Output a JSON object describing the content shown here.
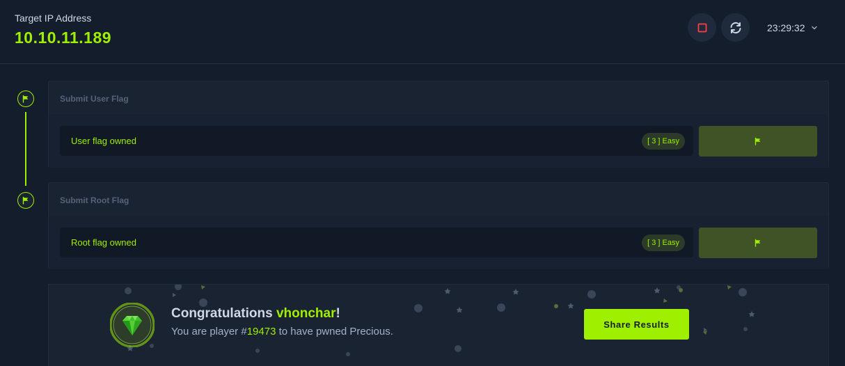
{
  "header": {
    "ip_label": "Target IP Address",
    "ip_value": "10.10.11.189",
    "timer": "23:29:32"
  },
  "icons": {
    "stop": "stop-square-icon",
    "reset": "refresh-icon",
    "chevron": "chevron-down-icon",
    "flag": "flag-icon",
    "gem": "green-gem-icon"
  },
  "flags": [
    {
      "title": "Submit User Flag",
      "status": "User flag owned",
      "difficulty": "[ 3 ] Easy"
    },
    {
      "title": "Submit Root Flag",
      "status": "Root flag owned",
      "difficulty": "[ 3 ] Easy"
    }
  ],
  "congrats": {
    "prefix": "Congratulations ",
    "username": "vhonchar",
    "suffix": "!",
    "sub_prefix": "You are player #",
    "player_number": "19473",
    "sub_suffix": " to have pwned Precious.",
    "share_label": "Share Results"
  },
  "colors": {
    "accent": "#9fef00",
    "background": "#141d2b",
    "card": "#1a2332",
    "stop_red": "#ff3e3e"
  }
}
